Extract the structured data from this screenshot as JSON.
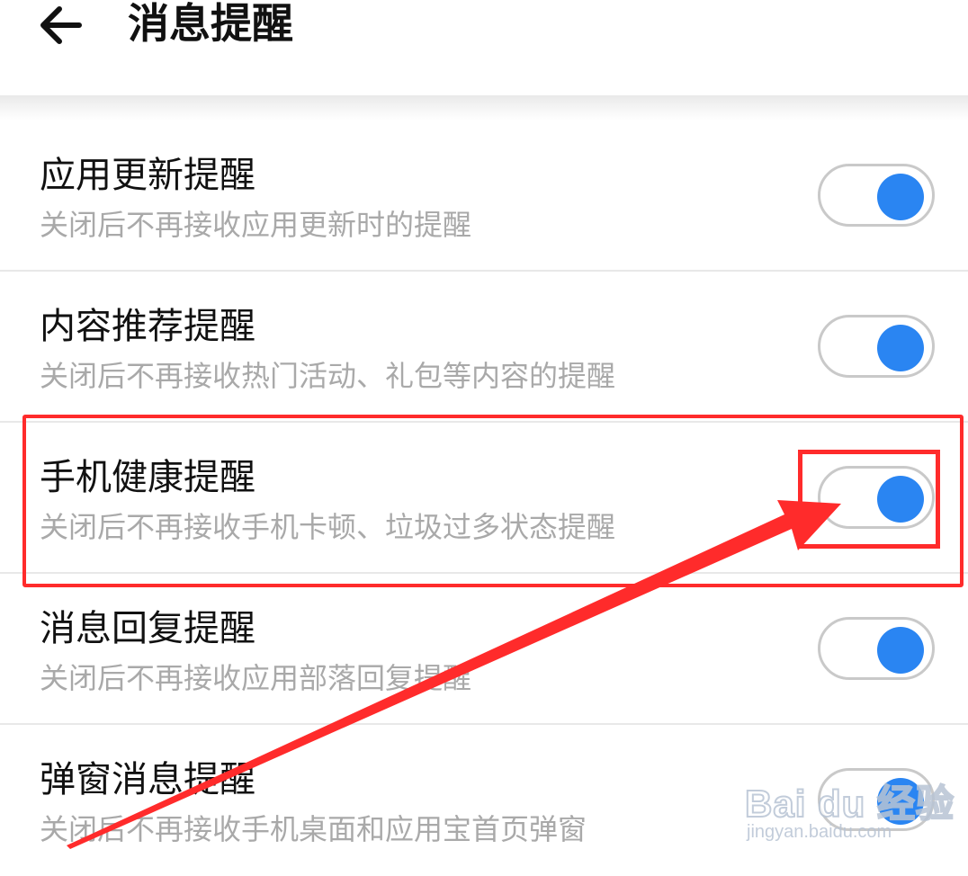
{
  "header": {
    "back_icon": "arrow-left-icon",
    "title": "消息提醒"
  },
  "items": [
    {
      "title": "应用更新提醒",
      "desc": "关闭后不再接收应用更新时的提醒",
      "enabled": true
    },
    {
      "title": "内容推荐提醒",
      "desc": "关闭后不再接收热门活动、礼包等内容的提醒",
      "enabled": true
    },
    {
      "title": "手机健康提醒",
      "desc": "关闭后不再接收手机卡顿、垃圾过多状态提醒",
      "enabled": true
    },
    {
      "title": "消息回复提醒",
      "desc": "关闭后不再接收应用部落回复提醒",
      "enabled": true
    },
    {
      "title": "弹窗消息提醒",
      "desc": "关闭后不再接收手机桌面和应用宝首页弹窗",
      "enabled": true
    }
  ],
  "annotation": {
    "color": "#ff2b2b",
    "highlighted_item": "手机健康提醒"
  },
  "watermark": {
    "main": "Bai du 经验",
    "sub": "jingyan.baidu.com"
  },
  "colors": {
    "toggle_on": "#2a85f2",
    "toggle_border": "#c9c9c9",
    "title_text": "#111111",
    "desc_text": "#a9a9a9"
  }
}
